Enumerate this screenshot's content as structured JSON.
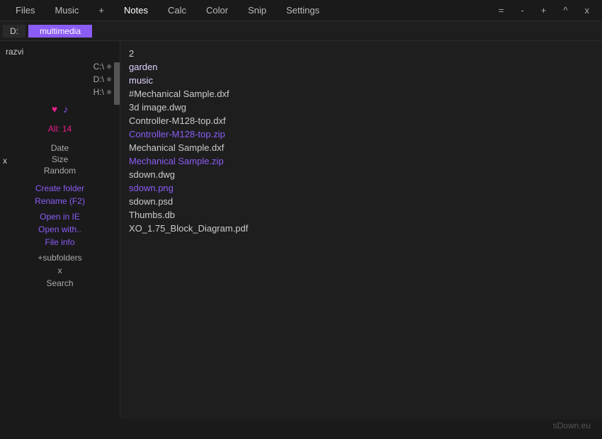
{
  "menu": {
    "items": [
      {
        "label": "Files",
        "active": false
      },
      {
        "label": "Music",
        "active": false
      },
      {
        "label": "+",
        "active": false
      },
      {
        "label": "Notes",
        "active": true
      },
      {
        "label": "Calc",
        "active": false
      },
      {
        "label": "Color",
        "active": false
      },
      {
        "label": "Snip",
        "active": false
      },
      {
        "label": "Settings",
        "active": false
      }
    ],
    "controls": [
      "=",
      "-",
      "+",
      "^",
      "x"
    ]
  },
  "pathbar": {
    "drive": "D:",
    "folder": "multimedia"
  },
  "left": {
    "drives": [
      {
        "label": "C:\\"
      },
      {
        "label": "D:\\"
      },
      {
        "label": "H:\\"
      }
    ],
    "user": "razvi",
    "stats": {
      "all_label": "All: 14"
    },
    "sort_links": [
      "Date",
      "Size",
      "Random"
    ],
    "action_links": [
      "Create folder",
      "Rename (F2)",
      "Open in IE",
      "Open with..",
      "File info",
      "+subfolders",
      "x",
      "Search"
    ]
  },
  "files": {
    "items": [
      {
        "name": "2",
        "type": "num",
        "color": "normal"
      },
      {
        "name": "garden",
        "type": "folder",
        "color": "normal"
      },
      {
        "name": "music",
        "type": "folder",
        "color": "normal"
      },
      {
        "name": "#Mechanical Sample.dxf",
        "type": "file",
        "color": "normal"
      },
      {
        "name": "3d image.dwg",
        "type": "file",
        "color": "normal"
      },
      {
        "name": "Controller-M128-top.dxf",
        "type": "file",
        "color": "normal"
      },
      {
        "name": "Controller-M128-top.zip",
        "type": "file",
        "color": "purple"
      },
      {
        "name": "Mechanical Sample.dxf",
        "type": "file",
        "color": "normal"
      },
      {
        "name": "Mechanical Sample.zip",
        "type": "file",
        "color": "purple"
      },
      {
        "name": "sdown.dwg",
        "type": "file",
        "color": "normal"
      },
      {
        "name": "sdown.png",
        "type": "file",
        "color": "purple"
      },
      {
        "name": "sdown.psd",
        "type": "file",
        "color": "normal"
      },
      {
        "name": "Thumbs.db",
        "type": "file",
        "color": "normal"
      },
      {
        "name": "XO_1.75_Block_Diagram.pdf",
        "type": "file",
        "color": "normal"
      }
    ]
  },
  "watermark": "sDown.eu"
}
